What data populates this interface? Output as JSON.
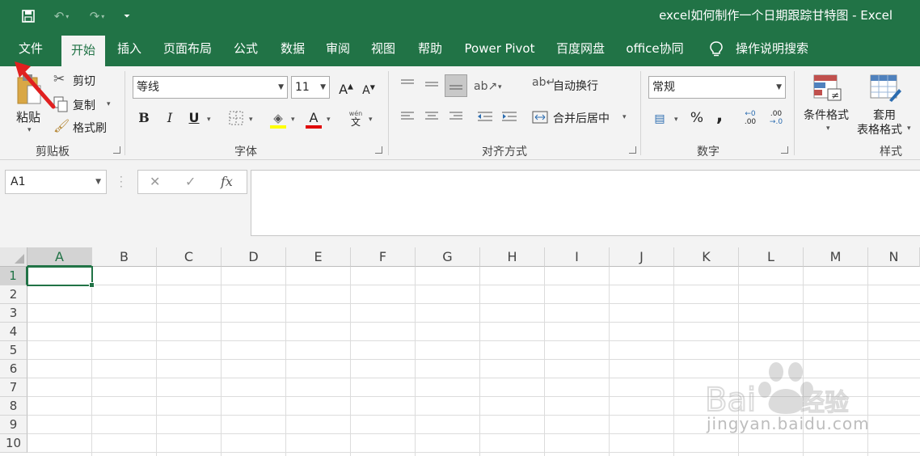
{
  "window": {
    "title": "excel如何制作一个日期跟踪甘特图  -  Excel"
  },
  "menu": {
    "items": [
      "文件",
      "开始",
      "插入",
      "页面布局",
      "公式",
      "数据",
      "审阅",
      "视图",
      "帮助",
      "Power Pivot",
      "百度网盘",
      "office协同"
    ],
    "active": "开始",
    "tell_me": "操作说明搜索"
  },
  "ribbon": {
    "clipboard": {
      "paste": "粘贴",
      "cut": "剪切",
      "copy": "复制",
      "format_painter": "格式刷",
      "label": "剪贴板"
    },
    "font": {
      "name": "等线",
      "size": "11",
      "label": "字体",
      "bold": "B",
      "italic": "I",
      "underline": "U",
      "font_color": "A",
      "phonetic_top": "wén",
      "phonetic_bottom": "文"
    },
    "alignment": {
      "wrap_text": "自动换行",
      "merge_center": "合并后居中",
      "label": "对齐方式"
    },
    "number": {
      "format": "常规",
      "percent": "%",
      "comma": ",",
      "inc_decimal_top": "←0",
      "inc_decimal_bottom": ".00",
      "dec_decimal_top": ".00",
      "dec_decimal_bottom": "→.0",
      "label": "数字"
    },
    "styles": {
      "conditional": "条件格式",
      "table_line1": "套用",
      "table_line2": "表格格式",
      "label": "样式"
    }
  },
  "formula_bar": {
    "name_box": "A1",
    "fx": "fx",
    "value": ""
  },
  "grid": {
    "columns": [
      "A",
      "B",
      "C",
      "D",
      "E",
      "F",
      "G",
      "H",
      "I",
      "J",
      "K",
      "L",
      "M",
      "N"
    ],
    "rows": [
      "1",
      "2",
      "3",
      "4",
      "5",
      "6",
      "7",
      "8",
      "9",
      "10"
    ],
    "active_cell": "A1"
  },
  "watermark": {
    "brand": "Baidu经验",
    "url": "jingyan.baidu.com"
  },
  "colors": {
    "accent": "#217346",
    "annotation": "#e02020"
  }
}
